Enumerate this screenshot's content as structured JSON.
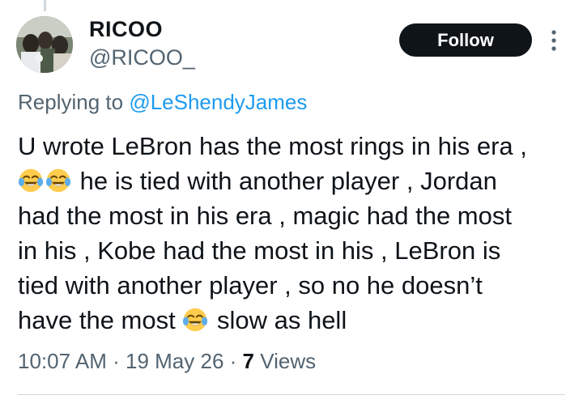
{
  "user": {
    "display_name": "RICOO",
    "handle": "@RICOO_"
  },
  "follow_button_label": "Follow",
  "more_icon": "vertical-ellipsis-icon",
  "reply_context": {
    "prefix": "Replying to",
    "mention": "@LeShendyJames"
  },
  "tweet": {
    "line_1": "U wrote LeBron has the most rings in his era ,",
    "line_2_emojis": [
      "face-with-tears-of-joy",
      "face-with-tears-of-joy"
    ],
    "line_2_text": "he is tied with another player , Jordan",
    "line_3": "had the most in his era , magic had the most",
    "line_4": "in his , Kobe had the most in his , LeBron is",
    "line_5": "tied with another player , so no he doesn’t",
    "line_6_before": "have the most",
    "line_6_emoji": "face-with-tears-of-joy",
    "line_6_after": "slow as hell"
  },
  "meta": {
    "time": "10:07 AM",
    "separator": "·",
    "date": "19 May 26",
    "views_count": "7",
    "views_label": "Views"
  },
  "colors": {
    "text_primary": "#0f1419",
    "text_secondary": "#536471",
    "link": "#1d9bf0",
    "follow_bg": "#0f1419",
    "divider": "#cfd9de"
  }
}
